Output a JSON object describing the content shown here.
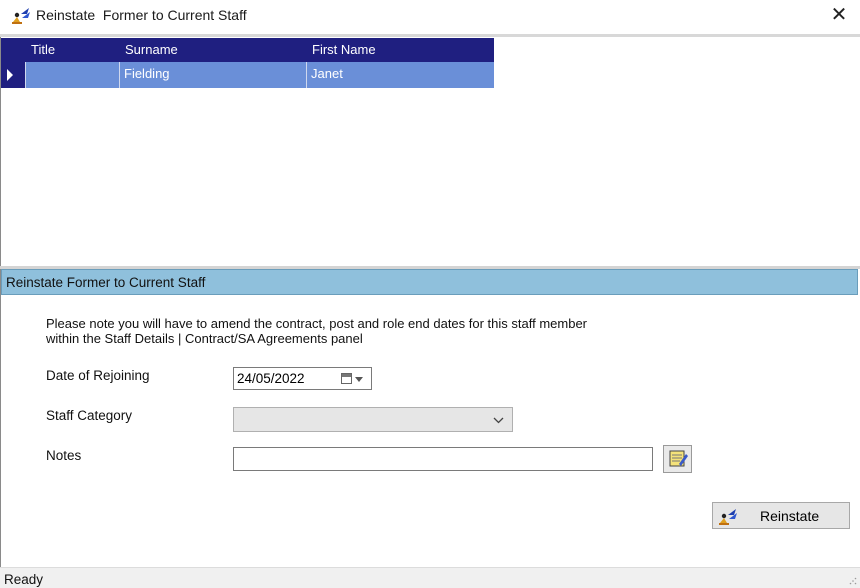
{
  "window": {
    "title": "Reinstate  Former to Current Staff",
    "close_glyph": "✕",
    "icon": "reinstate-staff-icon"
  },
  "grid": {
    "columns": [
      "Title",
      "Surname",
      "First Name"
    ],
    "rows": [
      {
        "title": "",
        "surname": "Fielding",
        "first_name": "Janet",
        "selected": true
      }
    ]
  },
  "panel": {
    "header": "Reinstate Former to Current Staff",
    "note_line1": "Please note you will have to amend the contract, post and role end dates for this staff member",
    "note_line2": "within the Staff Details | Contract/SA Agreements panel",
    "date_label": "Date of Rejoining",
    "date_value": "24/05/2022",
    "category_label": "Staff Category",
    "category_value": "",
    "notes_label": "Notes",
    "notes_value": "",
    "reinstate_label": "Reinstate"
  },
  "status": {
    "text": "Ready"
  },
  "colors": {
    "grid_header": "#1f1f80",
    "selected_row": "#6a8fd8",
    "panel_header": "#8fc0dc"
  }
}
